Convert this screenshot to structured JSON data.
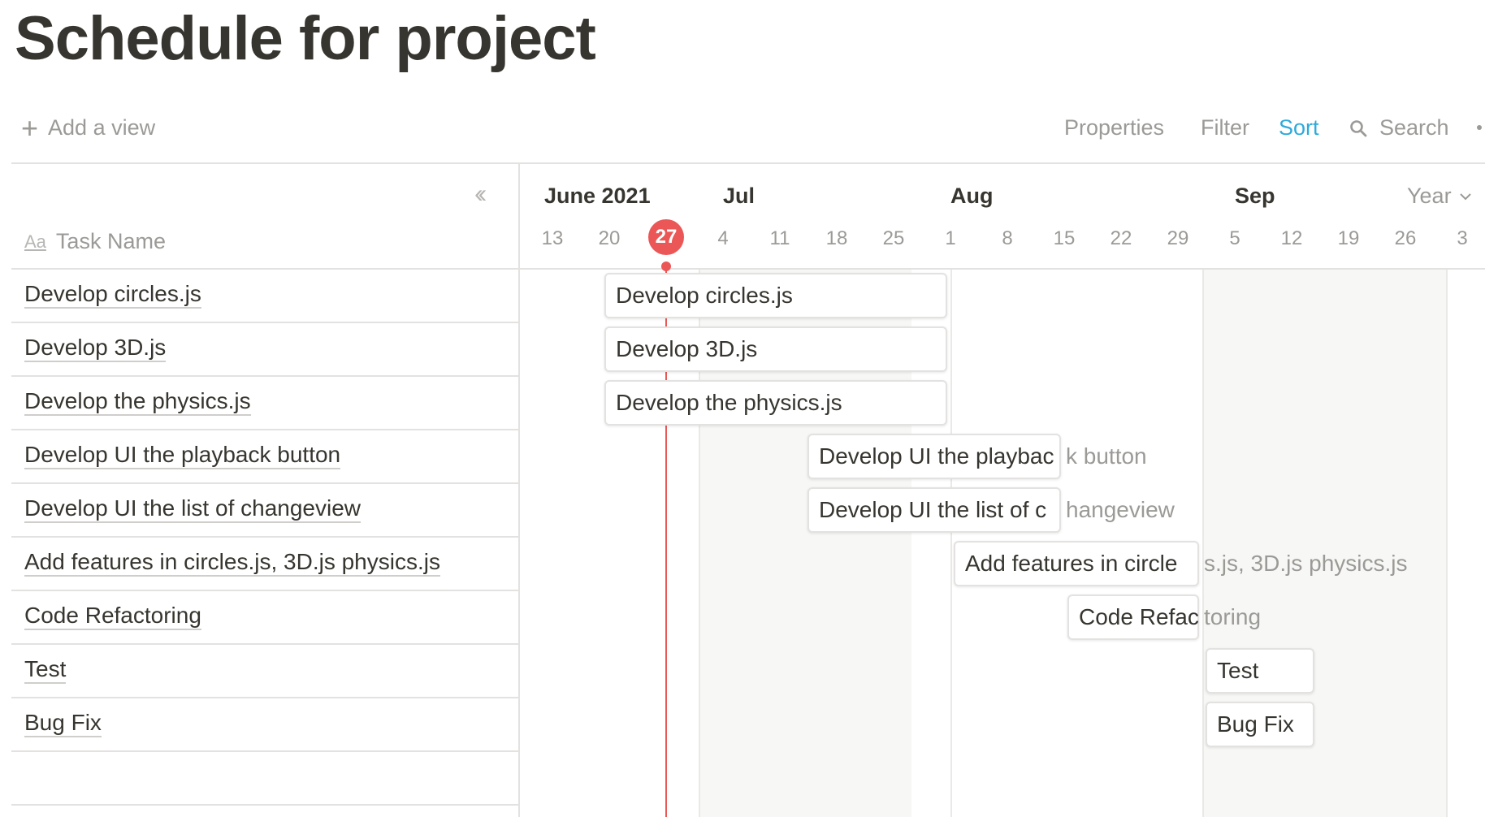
{
  "page": {
    "title": "Schedule for project"
  },
  "toolbar": {
    "add_view": "Add a view",
    "properties": "Properties",
    "filter": "Filter",
    "sort": "Sort",
    "search": "Search"
  },
  "table": {
    "header_icon": "Aa",
    "header": "Task Name",
    "rows": [
      "Develop circles.js",
      "Develop 3D.js",
      "Develop the physics.js",
      "Develop UI the playback button",
      "Develop UI the list of changeview",
      "Add features in circles.js, 3D.js physics.js",
      "Code Refactoring",
      "Test",
      "Bug Fix"
    ]
  },
  "timeline": {
    "months": [
      "June 2021",
      "Jul",
      "Aug",
      "Sep"
    ],
    "ticks": [
      "13",
      "20",
      "27",
      "4",
      "11",
      "18",
      "25",
      "1",
      "8",
      "15",
      "22",
      "29",
      "5",
      "12",
      "19",
      "26",
      "3"
    ],
    "today": "27",
    "zoom": "Year",
    "today_color": "#eb5757",
    "bars": [
      {
        "visible": "Develop circles.js",
        "overflow": ""
      },
      {
        "visible": "Develop 3D.js",
        "overflow": ""
      },
      {
        "visible": "Develop the physics.js",
        "overflow": ""
      },
      {
        "visible": "Develop UI the playbac",
        "overflow": "k button"
      },
      {
        "visible": "Develop UI the list of c",
        "overflow": "hangeview"
      },
      {
        "visible": "Add features in circle",
        "overflow": "s.js, 3D.js physics.js"
      },
      {
        "visible": "Code Refac",
        "overflow": "toring"
      },
      {
        "visible": "Test",
        "overflow": ""
      },
      {
        "visible": "Bug Fix",
        "overflow": ""
      }
    ]
  },
  "icons": {
    "add": "plus-icon",
    "search": "search-icon",
    "collapse": "double-chevron-left-icon",
    "zoom": "chevron-down-icon",
    "more": "more-icon"
  }
}
